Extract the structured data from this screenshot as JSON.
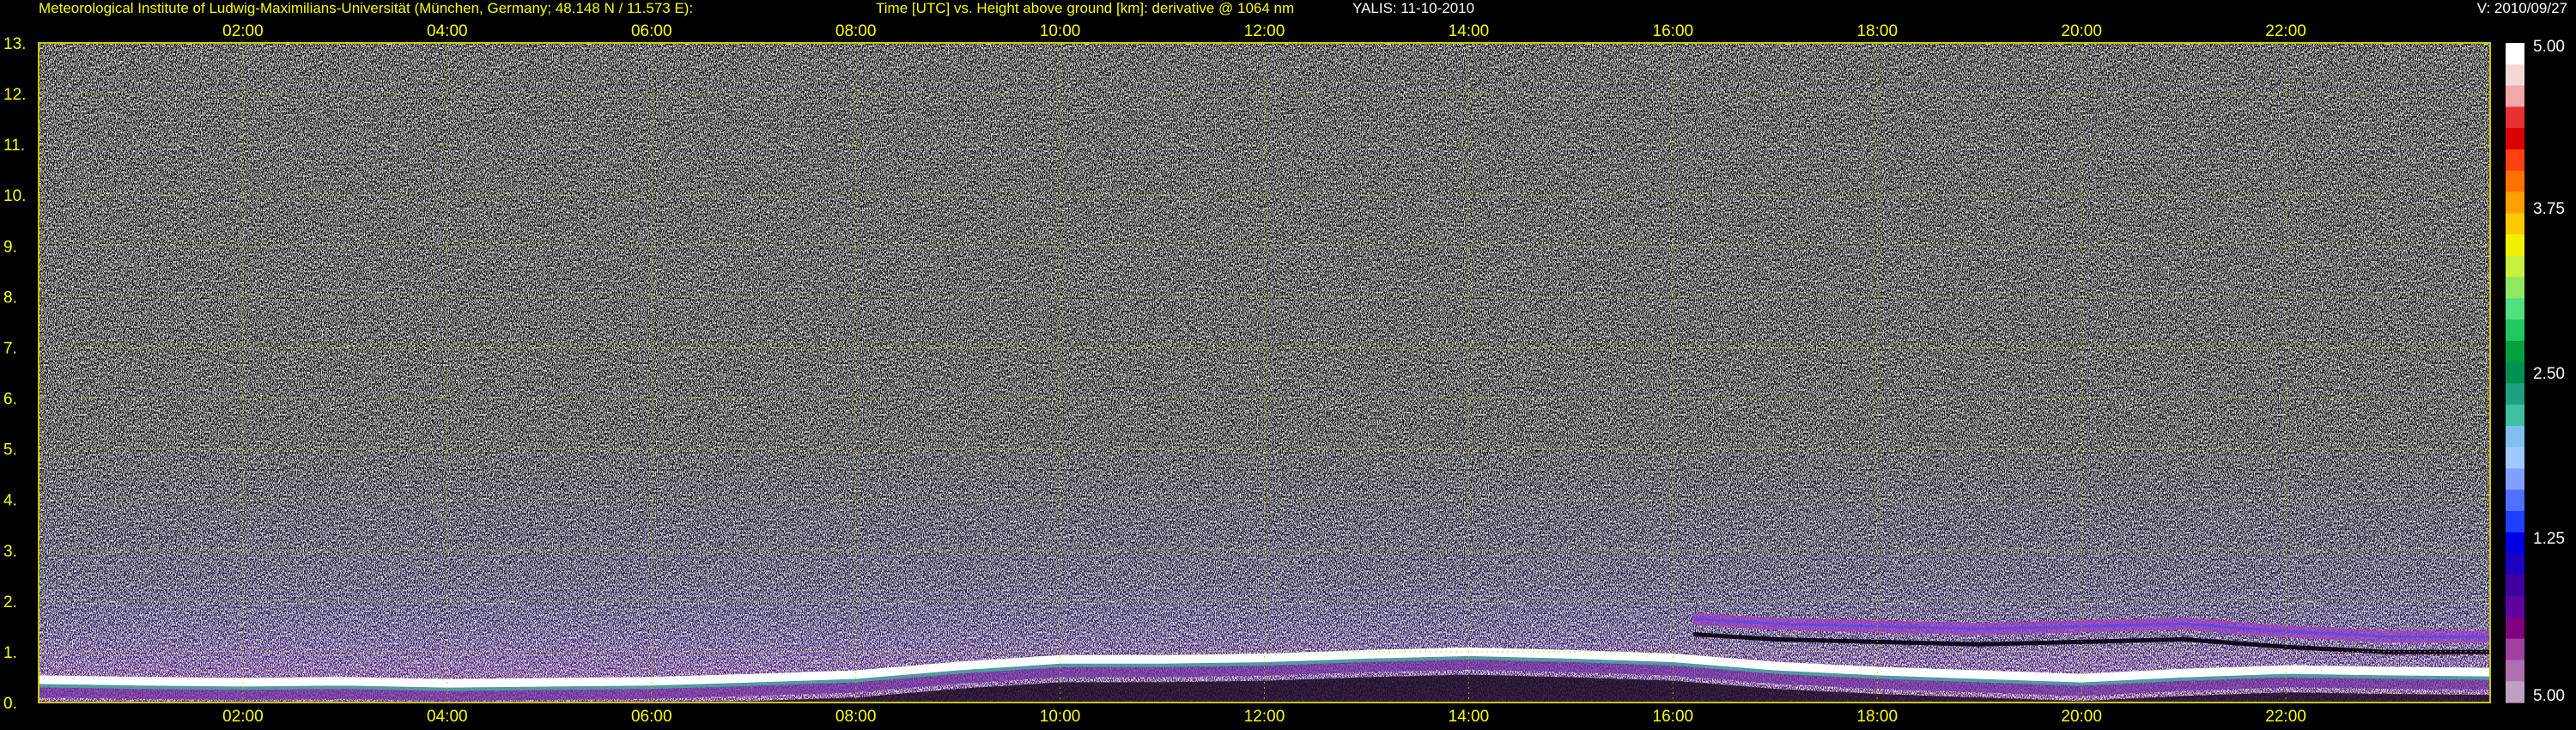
{
  "header": {
    "institute": "Meteorological Institute of Ludwig-Maximilians-Universität (München, Germany; 48.148 N / 11.573 E):",
    "plot_desc": "Time [UTC] vs. Height above ground [km]: derivative @ 1064 nm",
    "instrument_date": "YALIS: 11-10-2010",
    "version": "V: 2010/09/27"
  },
  "colors": {
    "background": "#000000",
    "axis_text": "#ffff00",
    "grid": "#c8c800",
    "header_white": "#ffffff"
  },
  "chart_data": {
    "type": "heatmap",
    "title": "Time [UTC] vs. Height above ground [km]: derivative @ 1064 nm",
    "xlabel": "Time [UTC]",
    "ylabel": "Height above ground [km]",
    "x_ticks": [
      "02:00",
      "04:00",
      "06:00",
      "08:00",
      "10:00",
      "12:00",
      "14:00",
      "16:00",
      "18:00",
      "20:00",
      "22:00"
    ],
    "x_tick_hours": [
      2,
      4,
      6,
      8,
      10,
      12,
      14,
      16,
      18,
      20,
      22
    ],
    "xlim_hours": [
      0,
      24
    ],
    "y_ticks": [
      "0.",
      "1.",
      "2.",
      "3.",
      "4.",
      "5.",
      "6.",
      "7.",
      "8.",
      "9.",
      "10.",
      "11.",
      "12.",
      "13."
    ],
    "y_tick_values": [
      0,
      1,
      2,
      3,
      4,
      5,
      6,
      7,
      8,
      9,
      10,
      11,
      12,
      13
    ],
    "ylim_km": [
      0,
      13
    ],
    "grid": true,
    "colorbar": {
      "position": "right",
      "tick_labels": [
        "5.00",
        "3.75",
        "2.50",
        "1.25",
        "5.00"
      ],
      "tick_values": [
        5.0,
        3.75,
        2.5,
        1.25,
        0.0
      ],
      "colors_top_to_bottom": [
        "#ffffff",
        "#f4d8d8",
        "#f0a8a8",
        "#e83030",
        "#d80000",
        "#ff4010",
        "#ff7000",
        "#ffa000",
        "#ffc800",
        "#f0f000",
        "#c8f040",
        "#90e860",
        "#50e080",
        "#20c860",
        "#00a040",
        "#009050",
        "#20a080",
        "#40c0a0",
        "#80c0f0",
        "#a0c8ff",
        "#80a0ff",
        "#5070ff",
        "#2040ff",
        "#0000e0",
        "#2000c0",
        "#4000a0",
        "#6000a0",
        "#800080",
        "#a040a0",
        "#b070b0",
        "#c0a0c0"
      ]
    },
    "boundary_layer_top_km": {
      "hours": [
        0,
        1,
        2,
        3,
        4,
        5,
        6,
        7,
        8,
        9,
        10,
        11,
        12,
        13,
        14,
        15,
        16,
        17,
        18,
        19,
        20,
        21,
        22,
        23,
        24
      ],
      "values": [
        0.45,
        0.42,
        0.4,
        0.42,
        0.38,
        0.4,
        0.42,
        0.48,
        0.55,
        0.72,
        0.85,
        0.85,
        0.88,
        0.95,
        1.0,
        0.95,
        0.88,
        0.72,
        0.62,
        0.55,
        0.48,
        0.58,
        0.65,
        0.62,
        0.6
      ]
    },
    "elevated_layer_km": {
      "hours": [
        16.2,
        17,
        18,
        19,
        20,
        21,
        22,
        23,
        24
      ],
      "values": [
        1.65,
        1.55,
        1.5,
        1.45,
        1.5,
        1.55,
        1.4,
        1.3,
        1.3
      ]
    }
  }
}
